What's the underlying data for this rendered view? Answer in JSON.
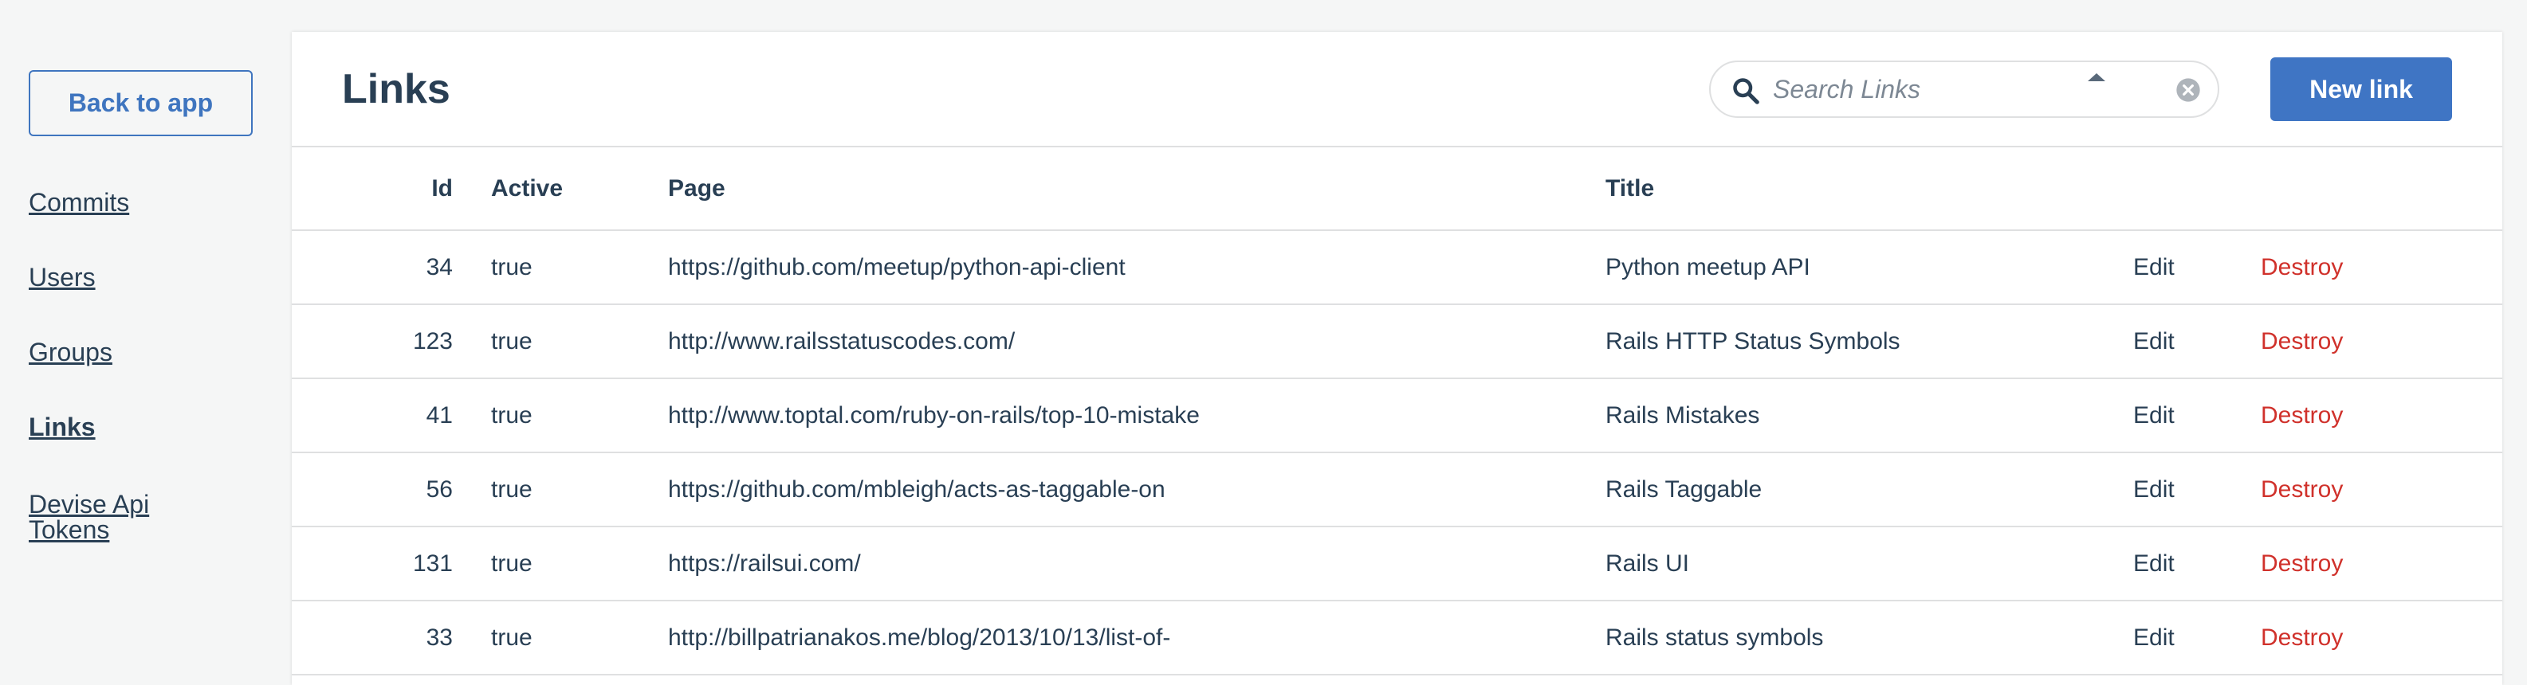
{
  "sidebar": {
    "back_label": "Back to app",
    "items": [
      {
        "label": "Commits"
      },
      {
        "label": "Users"
      },
      {
        "label": "Groups"
      },
      {
        "label": "Links"
      },
      {
        "label": "Devise Api Tokens"
      }
    ]
  },
  "header": {
    "title": "Links",
    "search_placeholder": "Search Links",
    "new_label": "New link"
  },
  "table": {
    "columns": [
      "Id",
      "Active",
      "Page",
      "Title"
    ],
    "sorted_column": "Title",
    "sort_direction": "ascending",
    "edit_label": "Edit",
    "destroy_label": "Destroy",
    "rows": [
      {
        "id": "34",
        "active": "true",
        "page": "https://github.com/meetup/python-api-client",
        "title": "Python meetup API"
      },
      {
        "id": "123",
        "active": "true",
        "page": "http://www.railsstatuscodes.com/",
        "title": "Rails HTTP Status Symbols"
      },
      {
        "id": "41",
        "active": "true",
        "page": "http://www.toptal.com/ruby-on-rails/top-10-mistake",
        "title": "Rails Mistakes"
      },
      {
        "id": "56",
        "active": "true",
        "page": "https://github.com/mbleigh/acts-as-taggable-on",
        "title": "Rails Taggable"
      },
      {
        "id": "131",
        "active": "true",
        "page": "https://railsui.com/",
        "title": "Rails UI"
      },
      {
        "id": "33",
        "active": "true",
        "page": "http://billpatrianakos.me/blog/2013/10/13/list-of-",
        "title": "Rails status symbols"
      }
    ]
  },
  "colors": {
    "accent": "#3f75c4",
    "text": "#293f54",
    "destroy": "#d0312b",
    "background": "#f5f6f6"
  }
}
